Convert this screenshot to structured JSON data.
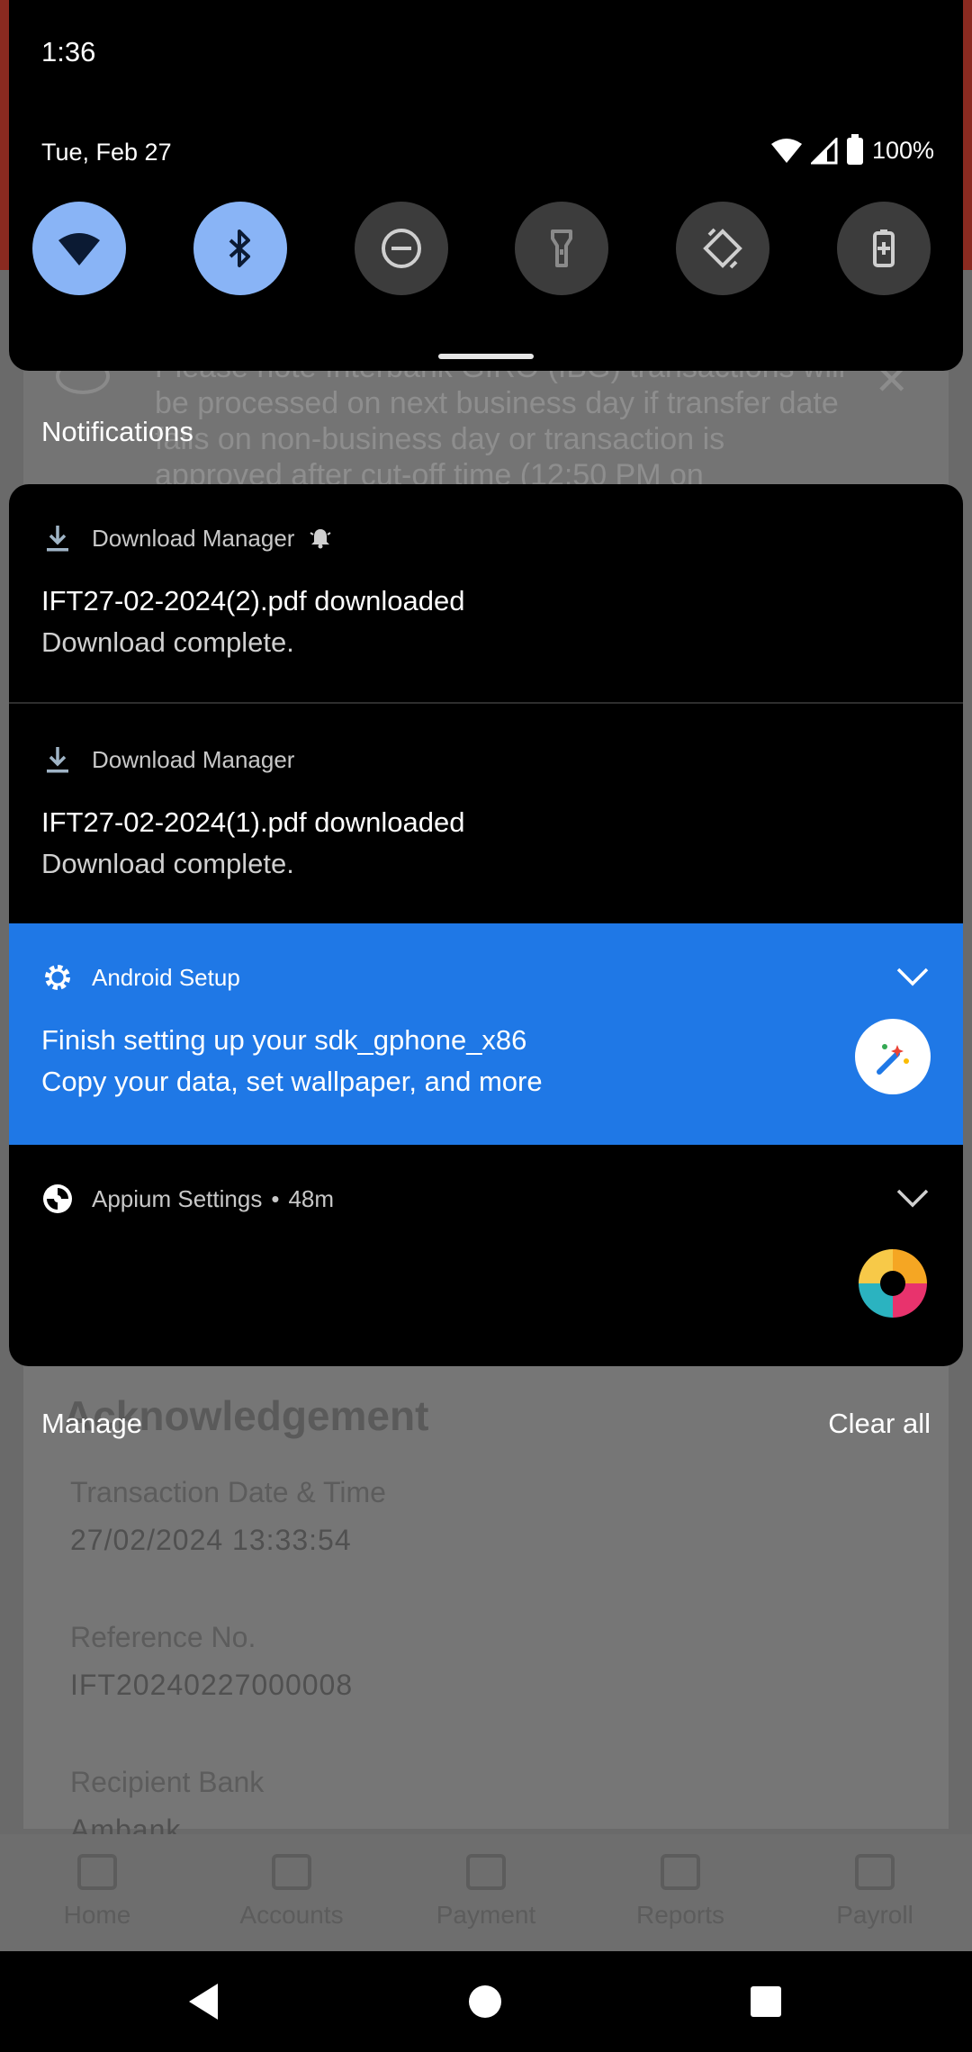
{
  "status_bar": {
    "time": "1:36"
  },
  "quick_settings": {
    "date": "Tue, Feb 27",
    "battery": "100%",
    "tiles": [
      {
        "name": "wifi",
        "active": true
      },
      {
        "name": "bluetooth",
        "active": true
      },
      {
        "name": "do-not-disturb",
        "active": false
      },
      {
        "name": "flashlight",
        "active": false
      },
      {
        "name": "auto-rotate",
        "active": false
      },
      {
        "name": "battery-saver",
        "active": false
      }
    ]
  },
  "background_app": {
    "info_text": "Please note Interbank GIRO (IBG) transactions will be processed on next business day if transfer date falls on non-business day or transaction is approved after cut-off time (12:50 PM on",
    "ack_title": "Acknowledgement",
    "fields": [
      {
        "label": "Transaction Date & Time",
        "value": "27/02/2024 13:33:54"
      },
      {
        "label": "Reference No.",
        "value": "IFT20240227000008"
      },
      {
        "label": "Recipient Bank",
        "value": "Ambank"
      }
    ],
    "nav": [
      "Home",
      "Accounts",
      "Payment",
      "Reports",
      "Payroll"
    ]
  },
  "notifications": {
    "heading": "Notifications",
    "items": [
      {
        "app": "Download Manager",
        "icon": "download-icon",
        "title": "IFT27-02-2024(2).pdf downloaded",
        "text": "Download complete.",
        "alerting": true
      },
      {
        "app": "Download Manager",
        "icon": "download-icon",
        "title": "IFT27-02-2024(1).pdf downloaded",
        "text": "Download complete."
      },
      {
        "app": "Android Setup",
        "icon": "gear-icon",
        "title": "Finish setting up your sdk_gphone_x86",
        "text": "Copy your data, set wallpaper, and more",
        "color": "#1f78e6"
      },
      {
        "app": "Appium Settings",
        "time": "48m",
        "icon": "appium-icon"
      }
    ],
    "manage_label": "Manage",
    "clear_all_label": "Clear all"
  }
}
